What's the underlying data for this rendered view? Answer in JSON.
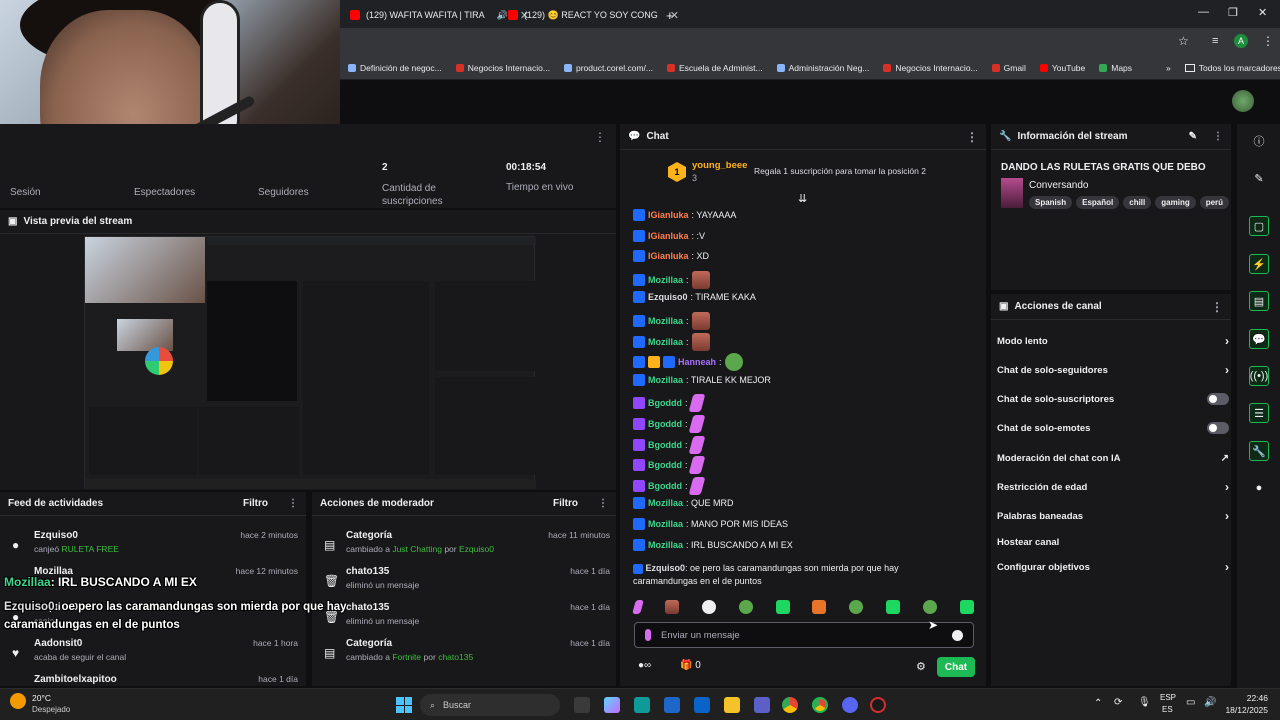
{
  "browser": {
    "tabs": [
      {
        "label": "(129) WAFITA WAFITA | TIRA"
      },
      {
        "label": "(129) 😊 REACT YO SOY CONG"
      }
    ],
    "bookmarks": [
      "Definición de negoc...",
      "Negocios Internacio...",
      "product.corel.com/...",
      "Escuela de Administ...",
      "Administración Neg...",
      "Negocios Internacio...",
      "Gmail",
      "YouTube",
      "Maps"
    ],
    "all_bookmarks": "Todos los marcadores",
    "profile_initial": "A"
  },
  "stats": {
    "labels_top": [
      "Sesión",
      "Espectadores",
      "Seguidores"
    ],
    "subs_value": "2",
    "subs_label": "Cantidad de suscripciones",
    "time_value": "00:18:54",
    "time_label": "Tiempo en vivo"
  },
  "preview": {
    "title": "Vista previa del stream"
  },
  "feed": {
    "title": "Feed de actividades",
    "filter": "Filtro",
    "items": [
      {
        "name": "Ezquiso0",
        "desc": "canjeó",
        "highlight": "RULETA FREE",
        "time": "hace 2 minutos"
      },
      {
        "name": "Mozillaa",
        "desc": "",
        "highlight": "",
        "time": "hace 12 minutos"
      },
      {
        "name": "Ezquiso0",
        "desc": "canjeó",
        "highlight": "",
        "time": "hace 1 hora"
      },
      {
        "name": "Aadonsit0",
        "desc": "acaba de seguir el canal",
        "highlight": "",
        "time": "hace 1 hora"
      },
      {
        "name": "Zambitoelxapitoo",
        "desc": "",
        "highlight": "",
        "time": "hace 1 día"
      }
    ]
  },
  "mod": {
    "title": "Acciones de moderador",
    "filter": "Filtro",
    "items": [
      {
        "name": "Categoría",
        "pre": "cambiado a",
        "target": "Just Chatting",
        "by": "por",
        "user": "Ezquiso0",
        "time": "hace 11 minutos"
      },
      {
        "name": "chato135",
        "pre": "eliminó un mensaje",
        "target": "",
        "by": "",
        "user": "",
        "time": "hace 1 día"
      },
      {
        "name": "chato135",
        "pre": "eliminó un mensaje",
        "target": "",
        "by": "",
        "user": "",
        "time": "hace 1 día"
      },
      {
        "name": "Categoría",
        "pre": "cambiado a",
        "target": "Fortnite",
        "by": "por",
        "user": "chato135",
        "time": "hace 1 día"
      }
    ]
  },
  "overlay": {
    "line1_name": "Mozillaa",
    "line1_text": ": IRL BUSCANDO A MI EX",
    "line2_name": "Ezquiso0",
    "line2_text": ": oe pero las caramandungas son mierda por que hay caramandungas en el de puntos"
  },
  "chat": {
    "title": "Chat",
    "leader_name": "young_beee",
    "leader_count": "3",
    "leader_rank": "1",
    "leader_promo": "Regala 1 suscripción para tomar la posición 2",
    "messages": [
      {
        "user": "IGianluka",
        "text": ": YAYAAAA",
        "color": "#ff7f50",
        "emote": ""
      },
      {
        "user": "IGianluka",
        "text": ": :V",
        "color": "#ff7f50",
        "emote": ""
      },
      {
        "user": "IGianluka",
        "text": ": XD",
        "color": "#ff7f50",
        "emote": ""
      },
      {
        "user": "Mozillaa",
        "text": ":",
        "color": "#3dd68c",
        "emote": "face"
      },
      {
        "user": "Ezquiso0",
        "text": ": TIRAME KAKA",
        "color": "#dedee3",
        "emote": ""
      },
      {
        "user": "Mozillaa",
        "text": ":",
        "color": "#3dd68c",
        "emote": "face"
      },
      {
        "user": "Mozillaa",
        "text": ":",
        "color": "#3dd68c",
        "emote": "face"
      },
      {
        "user": "Hanneah",
        "text": ":",
        "color": "#a970ff",
        "emote": "frog"
      },
      {
        "user": "Mozillaa",
        "text": ": TIRALE KK MEJOR",
        "color": "#3dd68c",
        "emote": ""
      },
      {
        "user": "Bgoddd",
        "text": ":",
        "color": "#3dd68c",
        "emote": "pink"
      },
      {
        "user": "Bgoddd",
        "text": ":",
        "color": "#3dd68c",
        "emote": "pink"
      },
      {
        "user": "Bgoddd",
        "text": ":",
        "color": "#3dd68c",
        "emote": "pink"
      },
      {
        "user": "Bgoddd",
        "text": ":",
        "color": "#3dd68c",
        "emote": "pink"
      },
      {
        "user": "Bgoddd",
        "text": ":",
        "color": "#3dd68c",
        "emote": "pink"
      },
      {
        "user": "Mozillaa",
        "text": ": QUE MRD",
        "color": "#3dd68c",
        "emote": ""
      },
      {
        "user": "Mozillaa",
        "text": ": MANO POR MIS IDEAS",
        "color": "#3dd68c",
        "emote": ""
      },
      {
        "user": "Mozillaa",
        "text": ": IRL BUSCANDO A MI EX",
        "color": "#3dd68c",
        "emote": ""
      }
    ],
    "last_user": "Ezquiso0",
    "last_text": ": oe pero las caramandungas son mierda por que hay caramandungas en el de puntos",
    "input_placeholder": "Enviar un mensaje",
    "points_value": "0",
    "send_label": "Chat"
  },
  "stream_info": {
    "title": "Información del stream",
    "stream_title": "DANDO LAS RULETAS GRATIS QUE DEBO",
    "category": "Conversando",
    "tags": [
      "Spanish",
      "Español",
      "chill",
      "gaming",
      "perú"
    ]
  },
  "channel_actions": {
    "title": "Acciones de canal",
    "items": [
      {
        "label": "Modo lento",
        "kind": "chevron"
      },
      {
        "label": "Chat de solo-seguidores",
        "kind": "chevron"
      },
      {
        "label": "Chat de solo-suscriptores",
        "kind": "toggle"
      },
      {
        "label": "Chat de solo-emotes",
        "kind": "toggle"
      },
      {
        "label": "Moderación del chat con IA",
        "kind": "external"
      },
      {
        "label": "Restricción de edad",
        "kind": "chevron"
      },
      {
        "label": "Palabras baneadas",
        "kind": "chevron"
      },
      {
        "label": "Hostear canal",
        "kind": "none"
      },
      {
        "label": "Configurar objetivos",
        "kind": "chevron"
      }
    ]
  },
  "taskbar": {
    "temp": "20°C",
    "weather": "Despejado",
    "search": "Buscar",
    "lang1": "ESP",
    "lang2": "ES",
    "time": "22:46",
    "date": "18/12/2025"
  }
}
